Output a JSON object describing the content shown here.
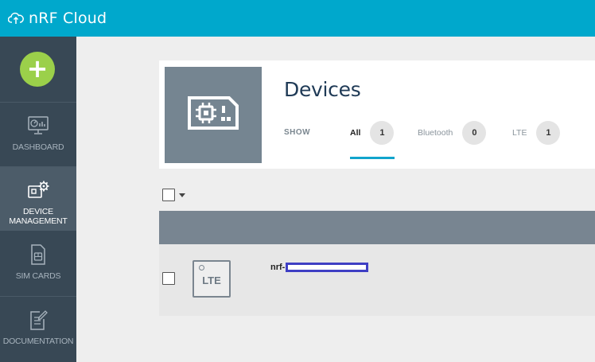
{
  "app": {
    "title": "nRF Cloud",
    "icon": "cloud-icon"
  },
  "sidebar": {
    "add_button": {
      "label": "+",
      "icon": "plus-icon",
      "color": "#9bd04a"
    },
    "items": [
      {
        "label": "DASHBOARD",
        "icon": "dashboard-icon",
        "active": false
      },
      {
        "label_line1": "DEVICE",
        "label_line2": "MANAGEMENT",
        "icon": "device-gear-icon",
        "active": true
      },
      {
        "label": "SIM CARDS",
        "icon": "sim-card-icon",
        "active": false
      },
      {
        "label": "DOCUMENTATION",
        "icon": "document-edit-icon",
        "active": false
      }
    ]
  },
  "header": {
    "title": "Devices",
    "thumbnail_icon": "device-board-icon",
    "show_label": "SHOW",
    "tabs": [
      {
        "label": "All",
        "count": "1",
        "active": true
      },
      {
        "label": "Bluetooth",
        "count": "0",
        "active": false
      },
      {
        "label": "LTE",
        "count": "1",
        "active": false
      }
    ]
  },
  "table": {
    "rows": [
      {
        "type_badge": "LTE",
        "name_prefix": "nrf-",
        "name_redacted": true
      }
    ]
  },
  "colors": {
    "topbar": "#00a8cc",
    "sidebar": "#384855",
    "sidebar_active": "#4c5c69",
    "title": "#1f3a56",
    "accent": "#11a4cc"
  }
}
